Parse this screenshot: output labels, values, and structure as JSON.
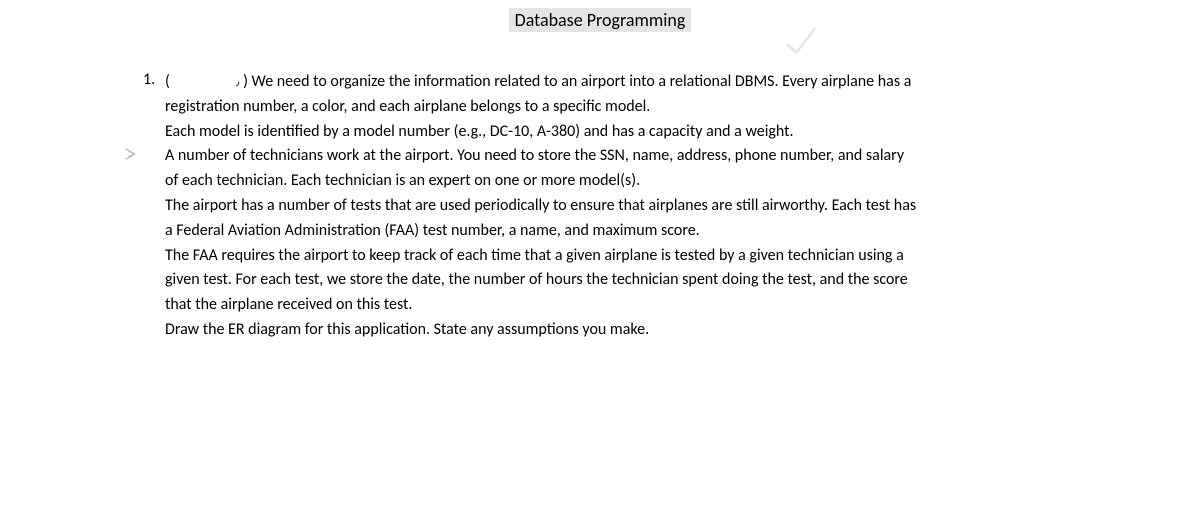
{
  "title": "Database Programming",
  "list_number": "1.",
  "paren_open": "(",
  "paren_close": ")",
  "small_mark": "٫",
  "paragraphs": [
    "We need to organize the information related to an airport into a relational DBMS. Every airplane has a registration number, a color, and each airplane belongs to a specific model.",
    "Each model is identified by a model number (e.g., DC-10, A-380) and has a capacity and a weight.",
    "A number of technicians work at the airport. You need to store the SSN, name, address, phone number, and salary of each technician. Each technician is an expert on one or more model(s).",
    "The airport has a number of tests that are used periodically to ensure that airplanes are still airworthy. Each test has a Federal Aviation Administration (FAA) test number, a name, and maximum score.",
    "The FAA requires the airport to keep track of each time that a given airplane is tested by a given technician using a given test. For each test, we store the date, the number of hours the technician spent doing the test, and the score that the airplane received on this test.",
    "Draw the ER diagram for this application. State any assumptions you make."
  ]
}
